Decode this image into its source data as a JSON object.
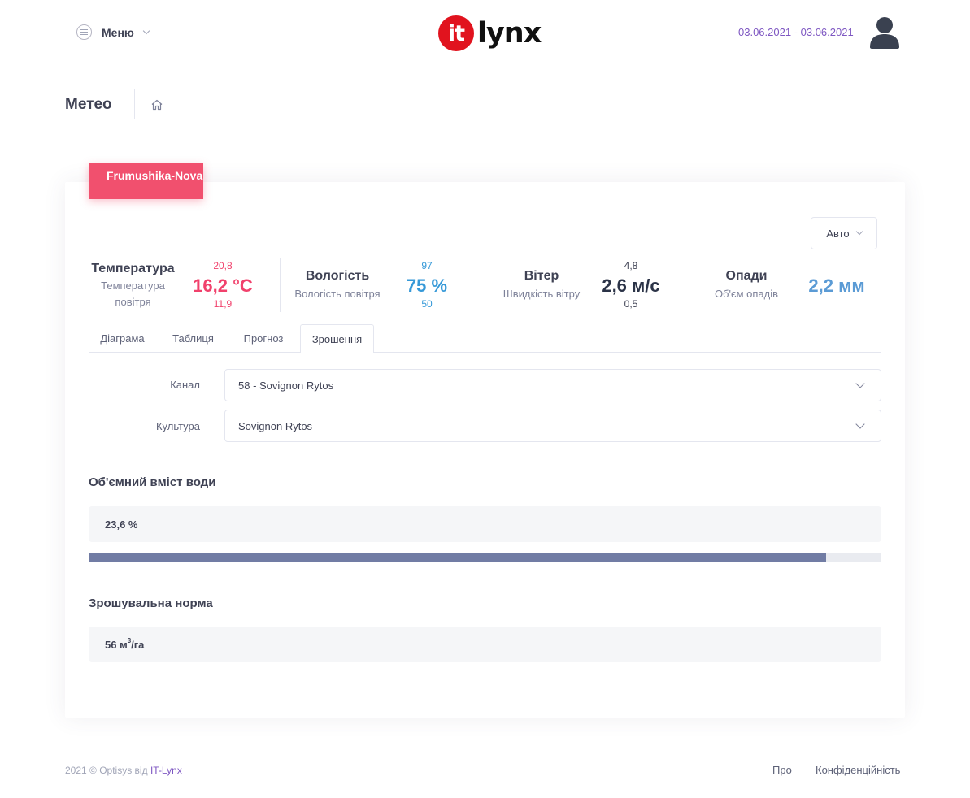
{
  "header": {
    "menu_label": "Меню",
    "logo_badge": "it",
    "logo_text": "lynx",
    "date_range": "03.06.2021 - 03.06.2021"
  },
  "page": {
    "title": "Метео"
  },
  "station": {
    "name": "Frumushika-Nova"
  },
  "mode_select": {
    "label": "Авто"
  },
  "stats": {
    "temperature": {
      "title": "Температура",
      "subtitle": "Температура повітря",
      "value": "16,2 °C",
      "max": "20,8",
      "min": "11,9"
    },
    "humidity": {
      "title": "Вологість",
      "subtitle": "Вологість повітря",
      "value": "75 %",
      "max": "97",
      "min": "50"
    },
    "wind": {
      "title": "Вітер",
      "subtitle": "Швидкість вітру",
      "value": "2,6 м/с",
      "max": "4,8",
      "min": "0,5"
    },
    "precipitation": {
      "title": "Опади",
      "subtitle": "Об'єм опадів",
      "value": "2,2 мм"
    }
  },
  "tabs": [
    {
      "label": "Діаграма"
    },
    {
      "label": "Таблиця"
    },
    {
      "label": "Прогноз"
    },
    {
      "label": "Зрошення"
    }
  ],
  "form": {
    "channel_label": "Канал",
    "channel_value": "58 - Sovignon Rytos",
    "culture_label": "Культура",
    "culture_value": "Sovignon Rytos"
  },
  "water_content": {
    "title": "Об'ємний вміст води",
    "value": "23,6 %",
    "progress_fraction": 0.93
  },
  "irrigation": {
    "title": "Зрошувальна норма",
    "value_number": "56 м",
    "value_sup": "3",
    "value_unit": "/га"
  },
  "footer": {
    "copyright": "2021 © Optisys від ",
    "brand": "IT-Lynx",
    "link_about": "Про",
    "link_privacy": "Конфіденційність"
  },
  "colors": {
    "accent_purple": "#7e57c2",
    "ribbon": "#f1506e",
    "temperature": "#f1416c",
    "humidity": "#3699d8",
    "wind": "#2b3347",
    "precipitation": "#5b9bd5",
    "progress": "#717ca4"
  }
}
